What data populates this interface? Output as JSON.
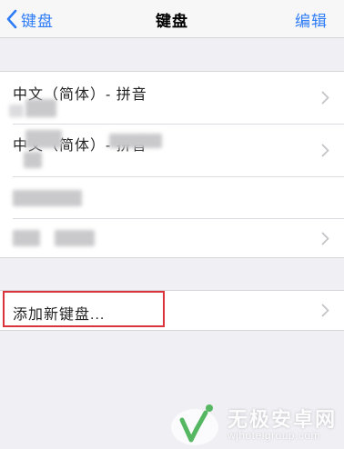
{
  "nav": {
    "back_label": "键盘",
    "title": "键盘",
    "edit_label": "编辑"
  },
  "keyboards": [
    {
      "label": "中文（简体）- 拼音"
    },
    {
      "label": "中文（简体）- 拼音"
    },
    {
      "label": ""
    },
    {
      "label": ""
    }
  ],
  "add_keyboard": {
    "label": "添加新键盘..."
  },
  "watermark": {
    "name": "无极安卓网",
    "url": "wjhotelgroup.com"
  },
  "colors": {
    "accent": "#2e7cf6",
    "highlight_border": "#d9343b",
    "background": "#efeff4"
  },
  "icons": {
    "back": "chevron-left-icon",
    "row": "chevron-right-icon"
  }
}
